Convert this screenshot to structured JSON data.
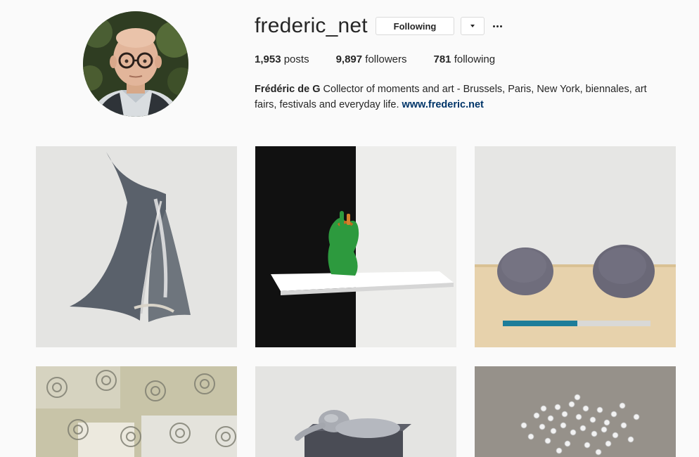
{
  "profile": {
    "username": "frederic_net",
    "following_button_label": "Following",
    "stats": {
      "posts_count": "1,953",
      "posts_label": "posts",
      "followers_count": "9,897",
      "followers_label": "followers",
      "following_count": "781",
      "following_label": "following"
    },
    "bio": {
      "name": "Frédéric de G",
      "text_line": "Collector of moments and art - Brussels, Paris, New York, biennales, art fairs, festivals and everyday life.",
      "link": "www.frederic.net"
    }
  },
  "icons": {
    "dropdown": "chevron-down-icon",
    "more": "more-options-icon"
  },
  "colors": {
    "background": "#fafafa",
    "text": "#262626",
    "link": "#003569",
    "button_border": "#dbdbdb"
  }
}
